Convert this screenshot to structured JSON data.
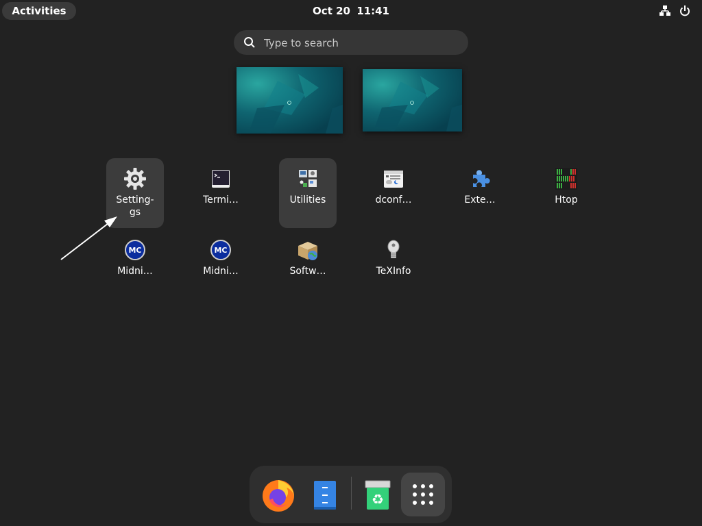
{
  "topbar": {
    "activities_label": "Activities",
    "date": "Oct 20",
    "time": "11:41",
    "tray": {
      "network_icon": "network-wired-icon",
      "power_icon": "power-icon"
    }
  },
  "search": {
    "placeholder": "Type to search",
    "value": ""
  },
  "workspaces": [
    {
      "name": "workspace-1"
    },
    {
      "name": "workspace-2"
    }
  ],
  "apps": [
    {
      "label": "Setting-",
      "label2": "gs",
      "icon": "gear-icon",
      "highlighted": true
    },
    {
      "label": "Termi…",
      "icon": "terminal-icon"
    },
    {
      "label": "Utilities",
      "icon": "utilities-folder-icon",
      "highlighted": true
    },
    {
      "label": "dconf…",
      "icon": "dconf-editor-icon"
    },
    {
      "label": "Exte…",
      "icon": "extensions-puzzle-icon"
    },
    {
      "label": "Htop",
      "icon": "htop-icon"
    },
    {
      "label": "Midni…",
      "icon": "midnight-commander-icon"
    },
    {
      "label": "Midni…",
      "icon": "midnight-commander-icon"
    },
    {
      "label": "Softw…",
      "icon": "software-package-icon"
    },
    {
      "label": "TeXInfo",
      "icon": "texinfo-icon"
    }
  ],
  "dock": [
    {
      "name": "Firefox",
      "icon": "firefox-icon"
    },
    {
      "name": "Files",
      "icon": "files-cabinet-icon"
    },
    {
      "name": "Trash",
      "icon": "trash-icon"
    },
    {
      "name": "Show Applications",
      "icon": "app-grid-icon"
    }
  ],
  "colors": {
    "background": "#222222",
    "panel": "#3a3a3a",
    "accent": "#3584e4"
  }
}
